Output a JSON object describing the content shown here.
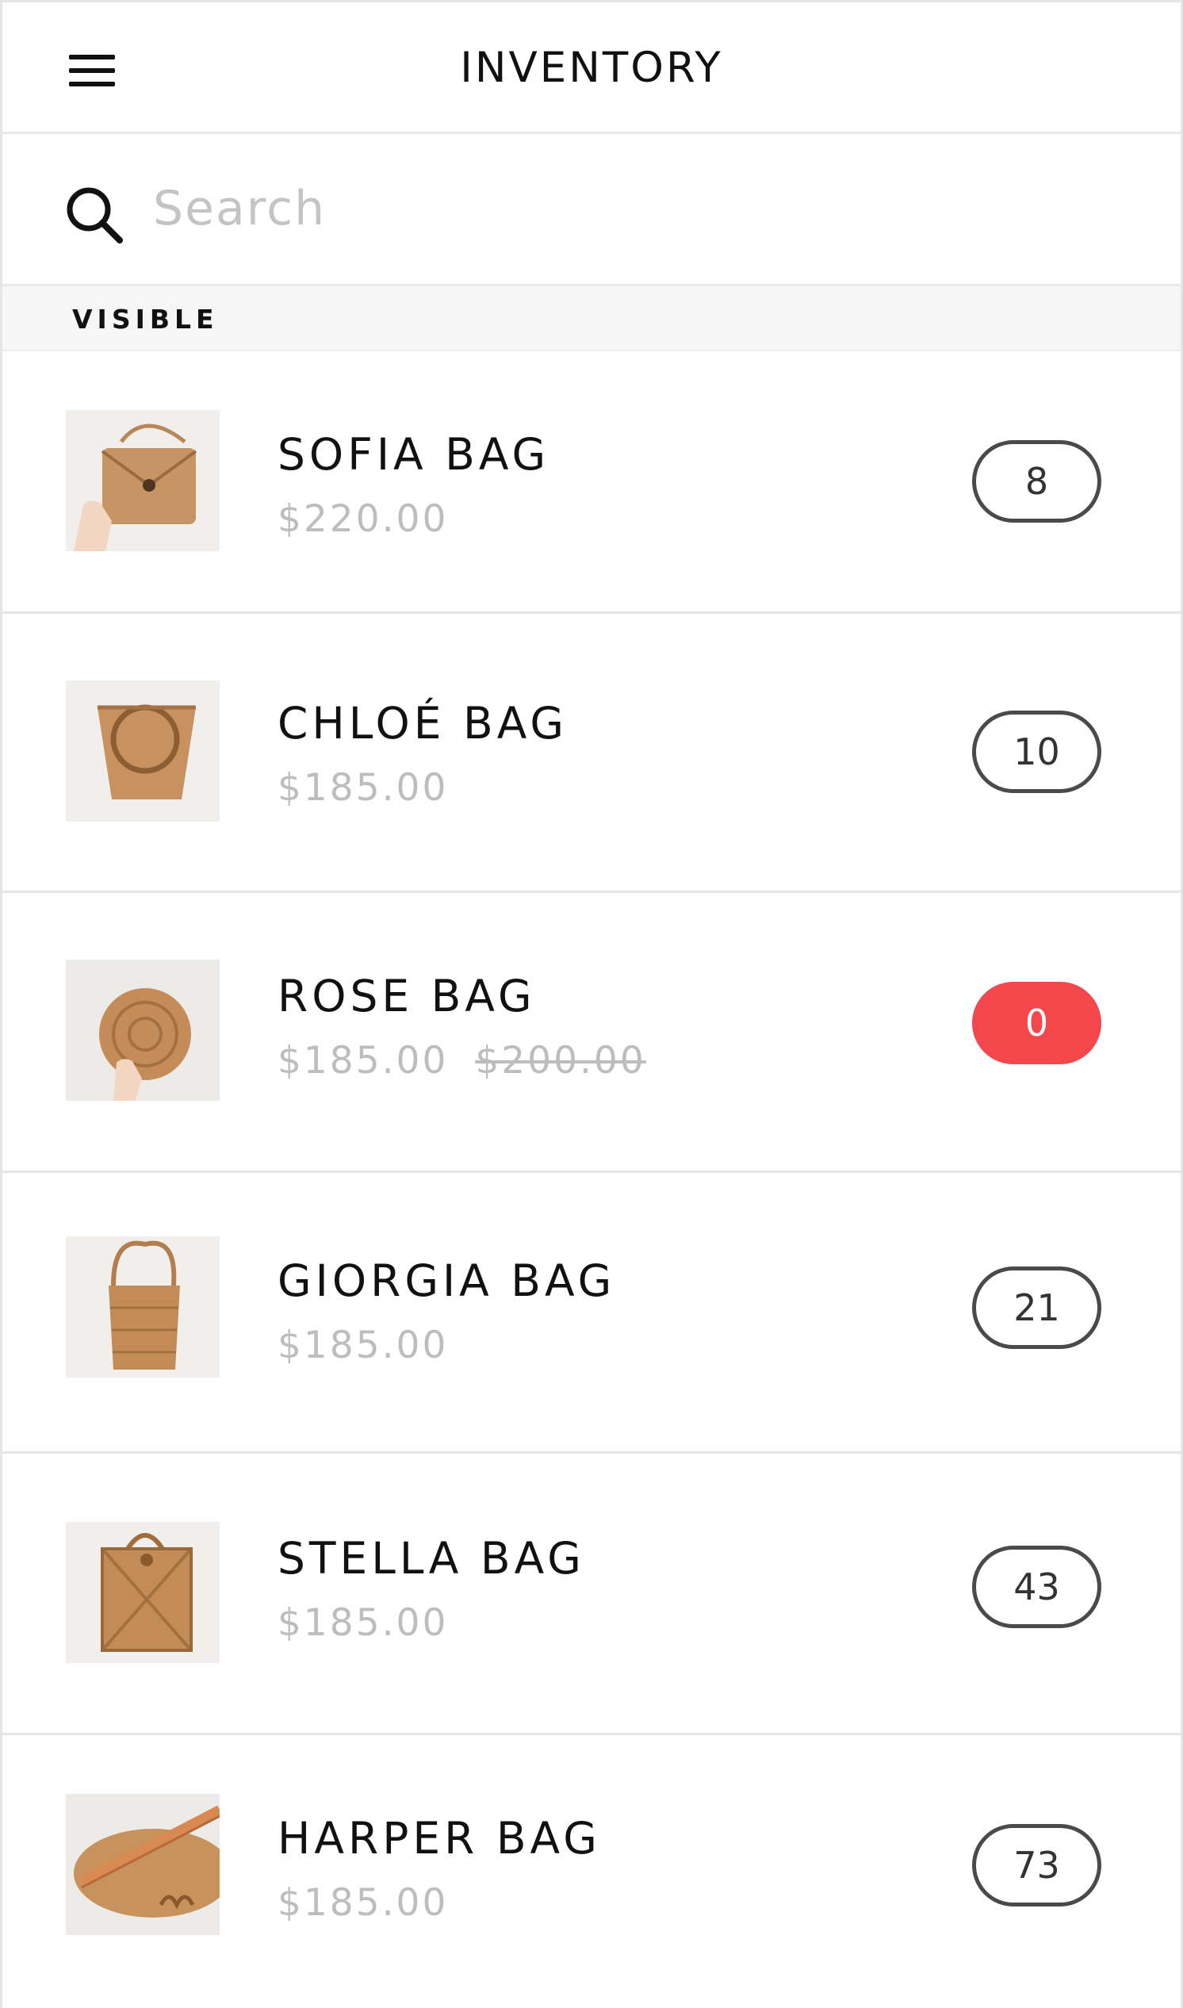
{
  "header": {
    "title": "INVENTORY",
    "menu_icon": "hamburger-menu-icon"
  },
  "search": {
    "placeholder": "Search",
    "value": "",
    "icon": "search-icon"
  },
  "section": {
    "label": "VISIBLE"
  },
  "colors": {
    "out_of_stock": "#f4474c",
    "price_gray": "#bdbdbd",
    "pill_border": "#4a4a4a"
  },
  "products": [
    {
      "name": "SOFIA BAG",
      "price": "$220.00",
      "original_price": "",
      "quantity": "8"
    },
    {
      "name": "CHLOÉ BAG",
      "price": "$185.00",
      "original_price": "",
      "quantity": "10"
    },
    {
      "name": "ROSE BAG",
      "price": "$185.00",
      "original_price": "$200.00",
      "quantity": "0"
    },
    {
      "name": "GIORGIA BAG",
      "price": "$185.00",
      "original_price": "",
      "quantity": "21"
    },
    {
      "name": "STELLA BAG",
      "price": "$185.00",
      "original_price": "",
      "quantity": "43"
    },
    {
      "name": "HARPER BAG",
      "price": "$185.00",
      "original_price": "",
      "quantity": "73"
    }
  ]
}
